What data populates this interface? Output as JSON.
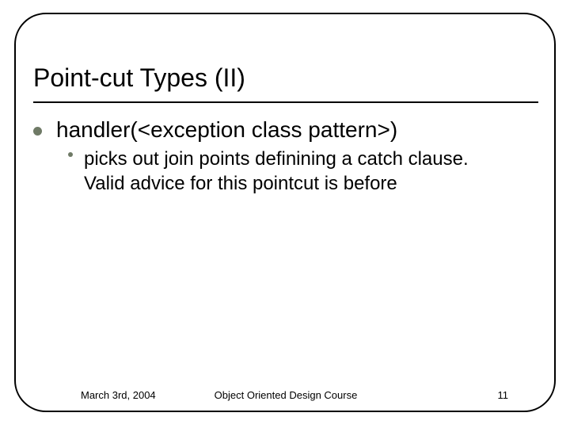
{
  "title": "Point-cut Types (II)",
  "bullets": {
    "lvl1_text": "handler(<exception class pattern>)",
    "lvl2_text": "picks out join points definining a catch clause.\nValid advice for this pointcut is before"
  },
  "footer": {
    "date": "March 3rd, 2004",
    "course": "Object Oriented Design Course",
    "page": "11"
  }
}
